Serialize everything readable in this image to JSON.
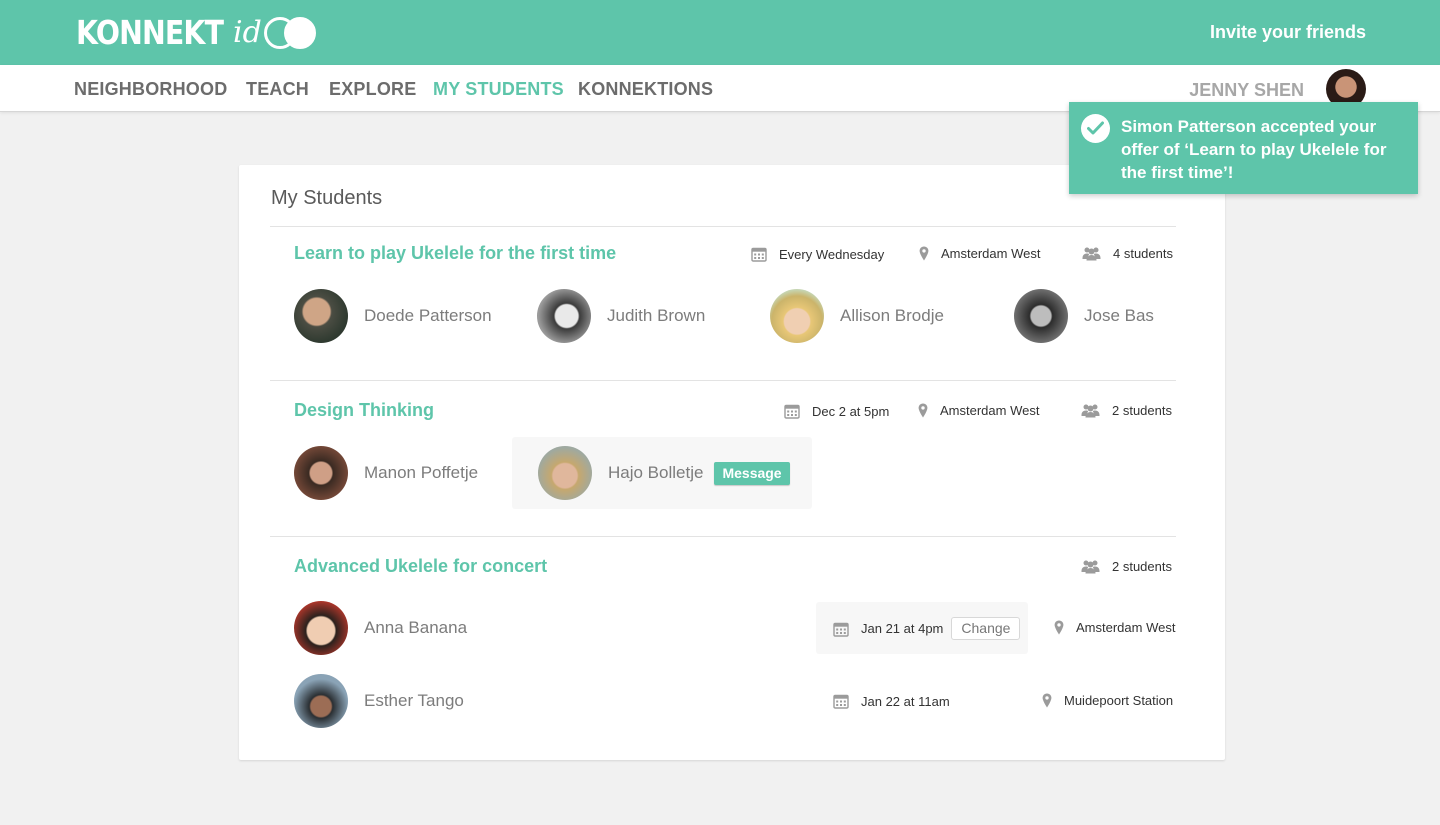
{
  "header": {
    "logo_main": "KONNEKT",
    "logo_suffix": "id",
    "invite_label": "Invite your friends"
  },
  "nav": {
    "items": [
      {
        "label": "NEIGHBORHOOD",
        "active": false
      },
      {
        "label": "TEACH",
        "active": false
      },
      {
        "label": "EXPLORE",
        "active": false
      },
      {
        "label": "MY STUDENTS",
        "active": true
      },
      {
        "label": "KONNEKTIONS",
        "active": false
      }
    ],
    "user_name": "JENNY SHEN"
  },
  "toast": {
    "message": "Simon Patterson accepted your offer of ‘Learn to play Ukelele for the first time’!"
  },
  "card": {
    "title": "My Students",
    "courses": [
      {
        "title": "Learn to play Ukelele for the first time",
        "schedule": "Every Wednesday",
        "location": "Amsterdam West",
        "students_count": "4 students",
        "students": [
          "Doede Patterson",
          "Judith Brown",
          "Allison Brodje",
          "Jose Bas"
        ]
      },
      {
        "title": "Design Thinking",
        "schedule": "Dec 2 at 5pm",
        "location": "Amsterdam West",
        "students_count": "2 students",
        "students": [
          "Manon Poffetje",
          "Hajo Bolletje"
        ],
        "message_label": "Message"
      },
      {
        "title": "Advanced Ukelele for concert",
        "students_count": "2 students",
        "students": [
          {
            "name": "Anna Banana",
            "date": "Jan 21 at 4pm",
            "location": "Amsterdam West",
            "change_label": "Change"
          },
          {
            "name": "Esther Tango",
            "date": "Jan 22 at 11am",
            "location": "Muidepoort Station"
          }
        ]
      }
    ]
  },
  "colors": {
    "brand": "#5ec5aa",
    "background": "#f1f1f1",
    "nav_text": "#6c6c6c"
  },
  "icons": [
    "calendar-icon",
    "location-pin-icon",
    "group-icon",
    "check-icon"
  ]
}
